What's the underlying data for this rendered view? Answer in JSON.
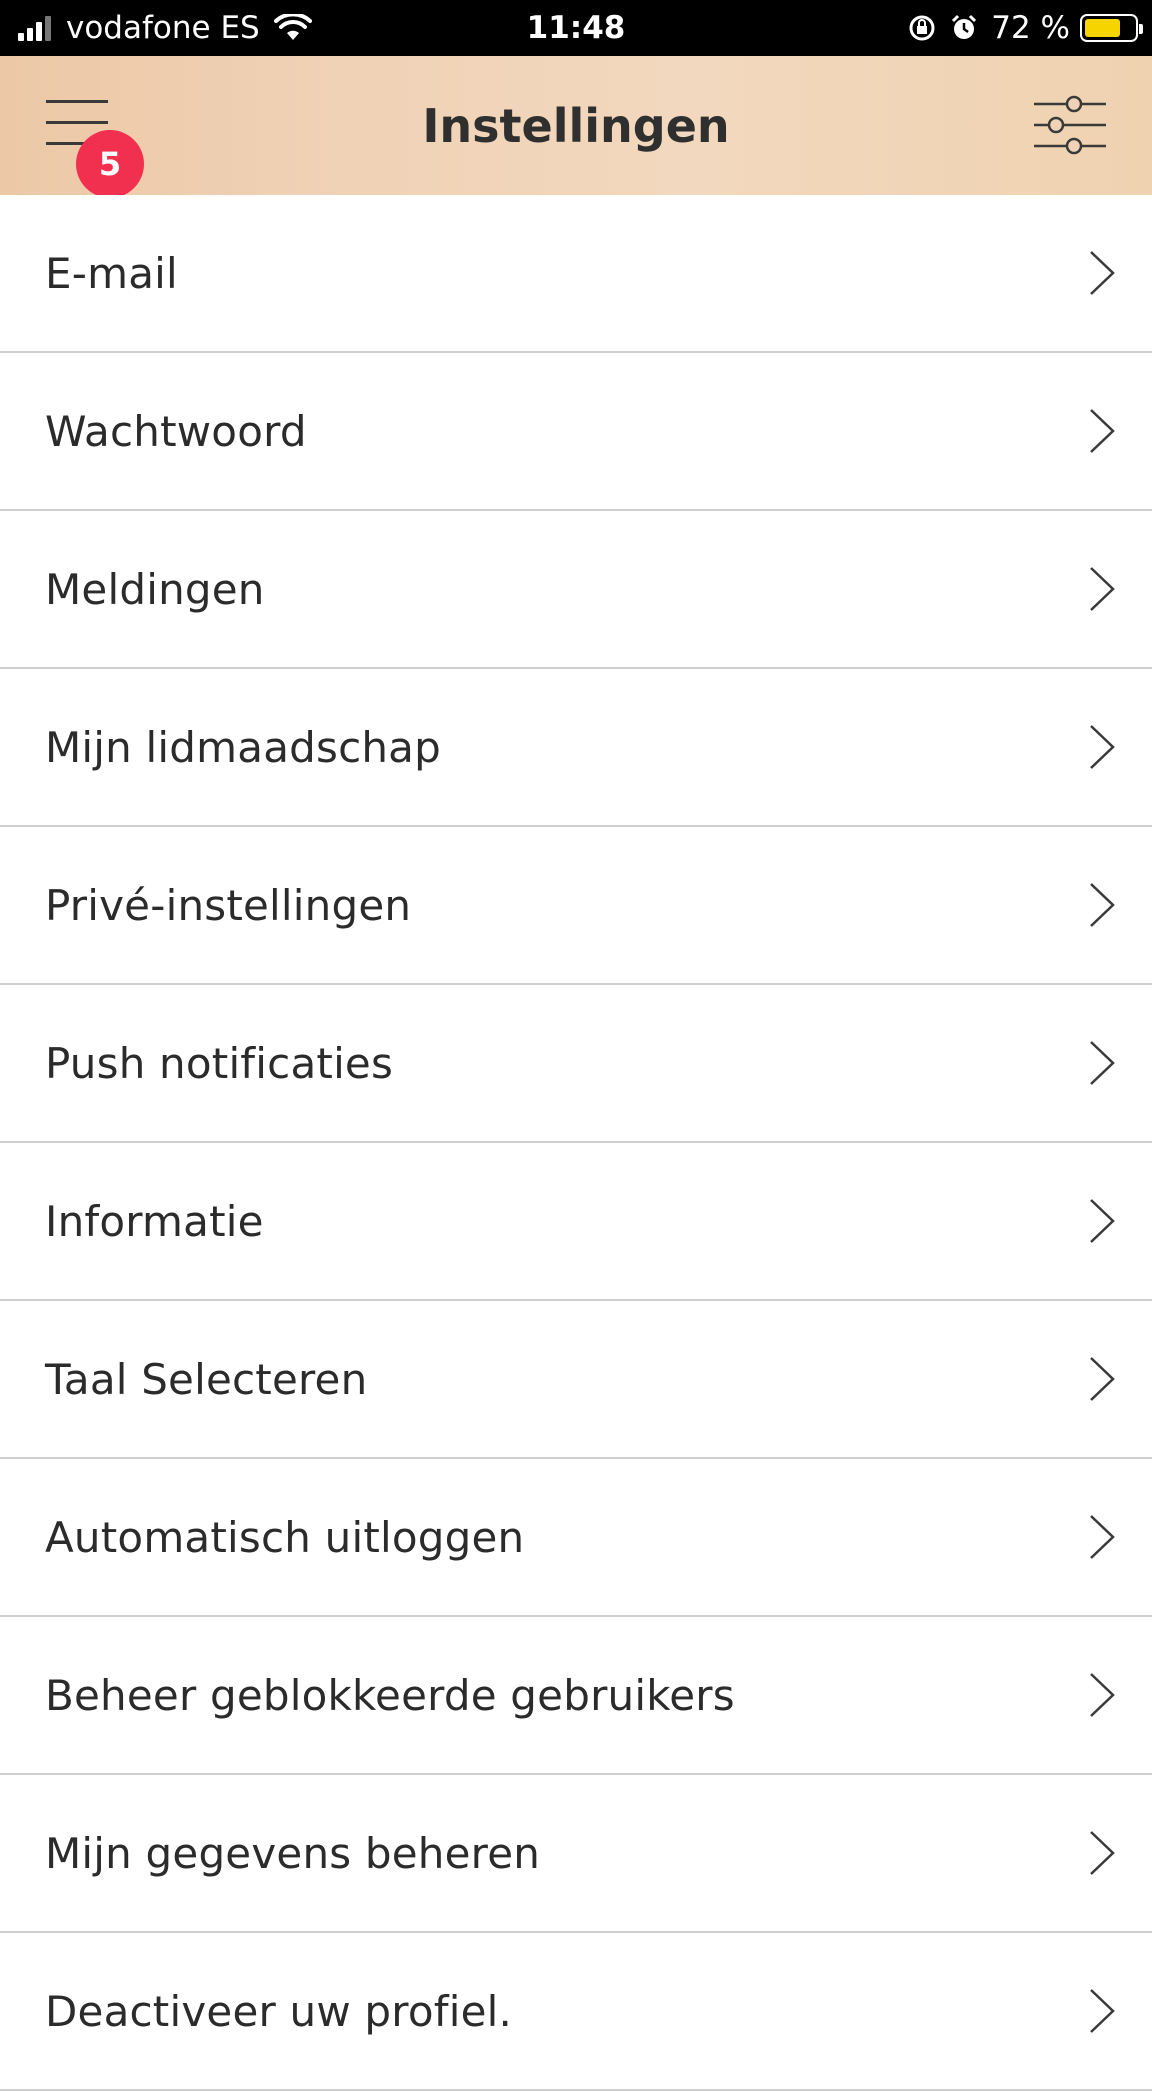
{
  "status_bar": {
    "carrier": "vodafone ES",
    "time": "11:48",
    "battery_percent": "72 %",
    "battery_level": 0.72,
    "battery_color": "#f5d400",
    "icons": [
      "signal-icon",
      "wifi-icon",
      "orientation-lock-icon",
      "alarm-icon",
      "battery-icon"
    ]
  },
  "header": {
    "title": "Instellingen",
    "badge_count": "5",
    "badge_color": "#f0304e",
    "left_icon": "hamburger-menu-icon",
    "right_icon": "filter-sliders-icon"
  },
  "settings": {
    "items": [
      {
        "label": "E-mail"
      },
      {
        "label": "Wachtwoord"
      },
      {
        "label": "Meldingen"
      },
      {
        "label": "Mijn lidmaadschap"
      },
      {
        "label": "Privé-instellingen"
      },
      {
        "label": "Push notificaties"
      },
      {
        "label": "Informatie"
      },
      {
        "label": "Taal Selecteren"
      },
      {
        "label": "Automatisch uitloggen"
      },
      {
        "label": "Beheer geblokkeerde gebruikers"
      },
      {
        "label": "Mijn gegevens beheren"
      },
      {
        "label": "Deactiveer uw profiel."
      }
    ],
    "row_icon": "chevron-right-icon"
  }
}
